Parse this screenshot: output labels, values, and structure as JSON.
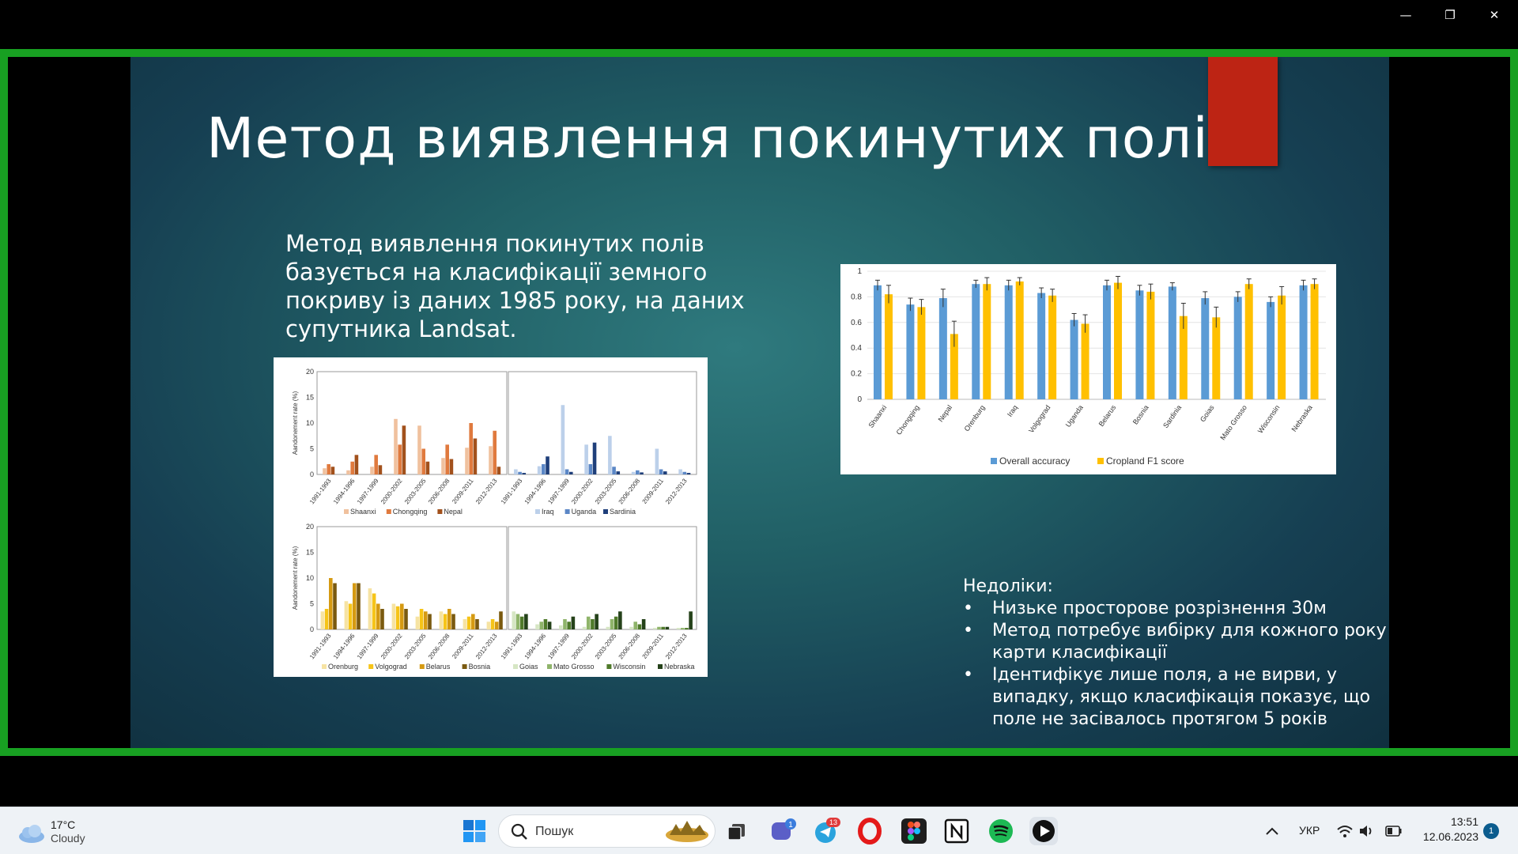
{
  "window": {
    "controls": [
      "minimize",
      "restore",
      "close"
    ]
  },
  "slide": {
    "title": "Метод виявлення покинутих полів",
    "body": "Метод виявлення покинутих полів базується на класифікації земного покриву із даних 1985 року, на даних супутника Landsat.",
    "accent_color": "#bd2414",
    "drawbacks_title": "Недоліки:",
    "drawbacks": [
      "Низьке просторове розрізнення 30м",
      "Метод потребує вибірку для кожного року карти класифікації",
      "Ідентифікує лише поля, а не вирви, у випадку, якщо класифікація показує, що поле не засівалось протягом 5 років"
    ]
  },
  "chart_data": [
    {
      "type": "bar",
      "ylabel": "Aandonement rate (%)",
      "ylim": [
        0,
        20
      ],
      "yticks": [
        "20",
        "15",
        "10",
        "5",
        "0"
      ],
      "categories": [
        "1991-1993",
        "1994-1996",
        "1997-1999",
        "2000-2002",
        "2003-2005",
        "2006-2008",
        "2009-2011",
        "2012-2013"
      ],
      "series": [
        {
          "name": "Shaanxi",
          "color": "#f0c19e",
          "values": [
            1.2,
            0.8,
            1.5,
            10.8,
            9.5,
            3.2,
            5.2,
            5.5
          ]
        },
        {
          "name": "Chongqing",
          "color": "#e07a3e",
          "values": [
            2.0,
            2.5,
            3.8,
            5.8,
            5.0,
            5.8,
            10.0,
            8.5
          ]
        },
        {
          "name": "Nepal",
          "color": "#a2511c",
          "values": [
            1.5,
            3.8,
            1.8,
            9.5,
            2.5,
            3.0,
            7.0,
            1.5
          ]
        }
      ]
    },
    {
      "type": "bar",
      "ylim": [
        0,
        20
      ],
      "categories": [
        "1991-1993",
        "1994-1996",
        "1997-1999",
        "2000-2002",
        "2003-2005",
        "2006-2008",
        "2009-2011",
        "2012-2013"
      ],
      "series": [
        {
          "name": "Iraq",
          "color": "#bcd0ea",
          "values": [
            1.0,
            1.6,
            13.5,
            5.8,
            7.5,
            0.5,
            5.0,
            1.0
          ]
        },
        {
          "name": "Uganda",
          "color": "#5b87c6",
          "values": [
            0.5,
            2.0,
            1.0,
            2.0,
            1.5,
            0.8,
            1.0,
            0.5
          ]
        },
        {
          "name": "Sardinia",
          "color": "#1f3f7a",
          "values": [
            0.3,
            3.5,
            0.5,
            6.2,
            0.6,
            0.4,
            0.6,
            0.3
          ]
        }
      ]
    },
    {
      "type": "bar",
      "ylabel": "Aandonement rate (%)",
      "ylim": [
        0,
        20
      ],
      "yticks": [
        "20",
        "15",
        "10",
        "5",
        "0"
      ],
      "categories": [
        "1991-1993",
        "1994-1996",
        "1997-1999",
        "2000-2002",
        "2003-2005",
        "2006-2008",
        "2009-2011",
        "2012-2013"
      ],
      "series": [
        {
          "name": "Orenburg",
          "color": "#f6e3a3",
          "values": [
            3.5,
            5.5,
            8.0,
            5.0,
            2.5,
            3.5,
            2.0,
            1.5
          ]
        },
        {
          "name": "Volgograd",
          "color": "#f6c418",
          "values": [
            4.0,
            5.0,
            7.0,
            4.5,
            4.0,
            3.0,
            2.5,
            2.0
          ]
        },
        {
          "name": "Belarus",
          "color": "#d59a12",
          "values": [
            10.0,
            9.0,
            5.0,
            5.0,
            3.5,
            4.0,
            3.0,
            1.5
          ]
        },
        {
          "name": "Bosnia",
          "color": "#7a5a10",
          "values": [
            9.0,
            9.0,
            4.0,
            4.0,
            3.0,
            3.0,
            2.0,
            3.5
          ]
        }
      ]
    },
    {
      "type": "bar",
      "ylim": [
        0,
        20
      ],
      "categories": [
        "1991-1993",
        "1994-1996",
        "1997-1999",
        "2000-2002",
        "2003-2005",
        "2006-2008",
        "2009-2011",
        "2012-2013"
      ],
      "series": [
        {
          "name": "Goias",
          "color": "#d6e6c4",
          "values": [
            3.5,
            1.0,
            0.8,
            0.5,
            0.5,
            0.5,
            0.3,
            0.3
          ]
        },
        {
          "name": "Mato Grosso",
          "color": "#8fb46a",
          "values": [
            3.0,
            1.5,
            2.0,
            2.5,
            2.0,
            1.5,
            0.5,
            0.3
          ]
        },
        {
          "name": "Wisconsin",
          "color": "#4f7a2a",
          "values": [
            2.5,
            2.0,
            1.5,
            2.0,
            2.5,
            1.0,
            0.5,
            0.3
          ]
        },
        {
          "name": "Nebraska",
          "color": "#25421a",
          "values": [
            3.0,
            1.5,
            2.5,
            3.0,
            3.5,
            2.0,
            0.5,
            3.5
          ]
        }
      ]
    },
    {
      "type": "bar",
      "ylim": [
        0,
        1
      ],
      "yticks": [
        "1",
        "0.8",
        "0.6",
        "0.4",
        "0.2",
        "0"
      ],
      "categories": [
        "Shaanxi",
        "Chongqing",
        "Nepal",
        "Orenburg",
        "Iraq",
        "Volgograd",
        "Uganda",
        "Belarus",
        "Bosnia",
        "Sardinia",
        "Goias",
        "Mato Grosso",
        "Wisconsin",
        "Nebraska"
      ],
      "series": [
        {
          "name": "Overall accuracy",
          "color": "#5b9bd5",
          "values": [
            0.89,
            0.74,
            0.79,
            0.9,
            0.89,
            0.83,
            0.62,
            0.89,
            0.85,
            0.88,
            0.79,
            0.8,
            0.76,
            0.89
          ],
          "errors": [
            0.04,
            0.05,
            0.07,
            0.03,
            0.04,
            0.04,
            0.05,
            0.04,
            0.04,
            0.03,
            0.05,
            0.04,
            0.04,
            0.04
          ]
        },
        {
          "name": "Cropland F1 score",
          "color": "#ffc000",
          "values": [
            0.82,
            0.72,
            0.51,
            0.9,
            0.92,
            0.81,
            0.59,
            0.91,
            0.84,
            0.65,
            0.64,
            0.9,
            0.81,
            0.9
          ],
          "errors": [
            0.07,
            0.06,
            0.1,
            0.05,
            0.03,
            0.05,
            0.07,
            0.05,
            0.06,
            0.1,
            0.08,
            0.04,
            0.07,
            0.04
          ]
        }
      ]
    }
  ],
  "taskbar": {
    "weather_temp": "17°C",
    "weather_desc": "Cloudy",
    "search_placeholder": "Пошук",
    "apps": [
      "windows-start",
      "task-view",
      "teams",
      "telegram",
      "opera",
      "figma",
      "notion",
      "spotify",
      "media-player"
    ],
    "badges": {
      "teams": "1",
      "telegram": "13"
    },
    "language": "УКР",
    "time": "13:51",
    "date": "12.06.2023",
    "notifications": "1"
  }
}
